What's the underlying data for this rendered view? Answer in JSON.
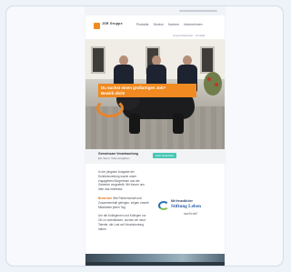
{
  "brand": {
    "logo_text": "JSR Gruppe",
    "accent": "#f08a21",
    "cta_color": "#47c7b5"
  },
  "nav": {
    "items": [
      "Produkte",
      "Service",
      "Karriere",
      "Unternehmen"
    ]
  },
  "utility": {
    "items": [
      "Ansprechpartner",
      "Kontakt"
    ]
  },
  "hero": {
    "headline_lines": [
      "Du suchst einen großartigen Job?",
      "Bewirb dich!"
    ]
  },
  "caption": {
    "title": "Gemeinsam Verantwortung",
    "subtitle": "Ein Team. Viele Aufgaben.",
    "cta_label": "Jetzt bewerben"
  },
  "body": {
    "paragraphs": [
      "In der jüngsten Ausgabe der Schützenzeitung wurde unser engagiertes Bürgerteam aus der Gewerbe vorgestellt. Wir freuen uns über das Interesse.",
      "Wie Partnerschaft und Zusammenhalt gelingen, zeigen unsere Mitarbeiter jeden Tag.",
      "Um die Kolleginnen und Kollegen vor Ort zu unterstützen, suchen wir neue Talente, die Lust auf Verantwortung haben."
    ],
    "link_text": "Bewerben"
  },
  "partner": {
    "line1": "Mit freundlicher",
    "line2": "Stiftung Leben",
    "line3": "macht mit!"
  }
}
